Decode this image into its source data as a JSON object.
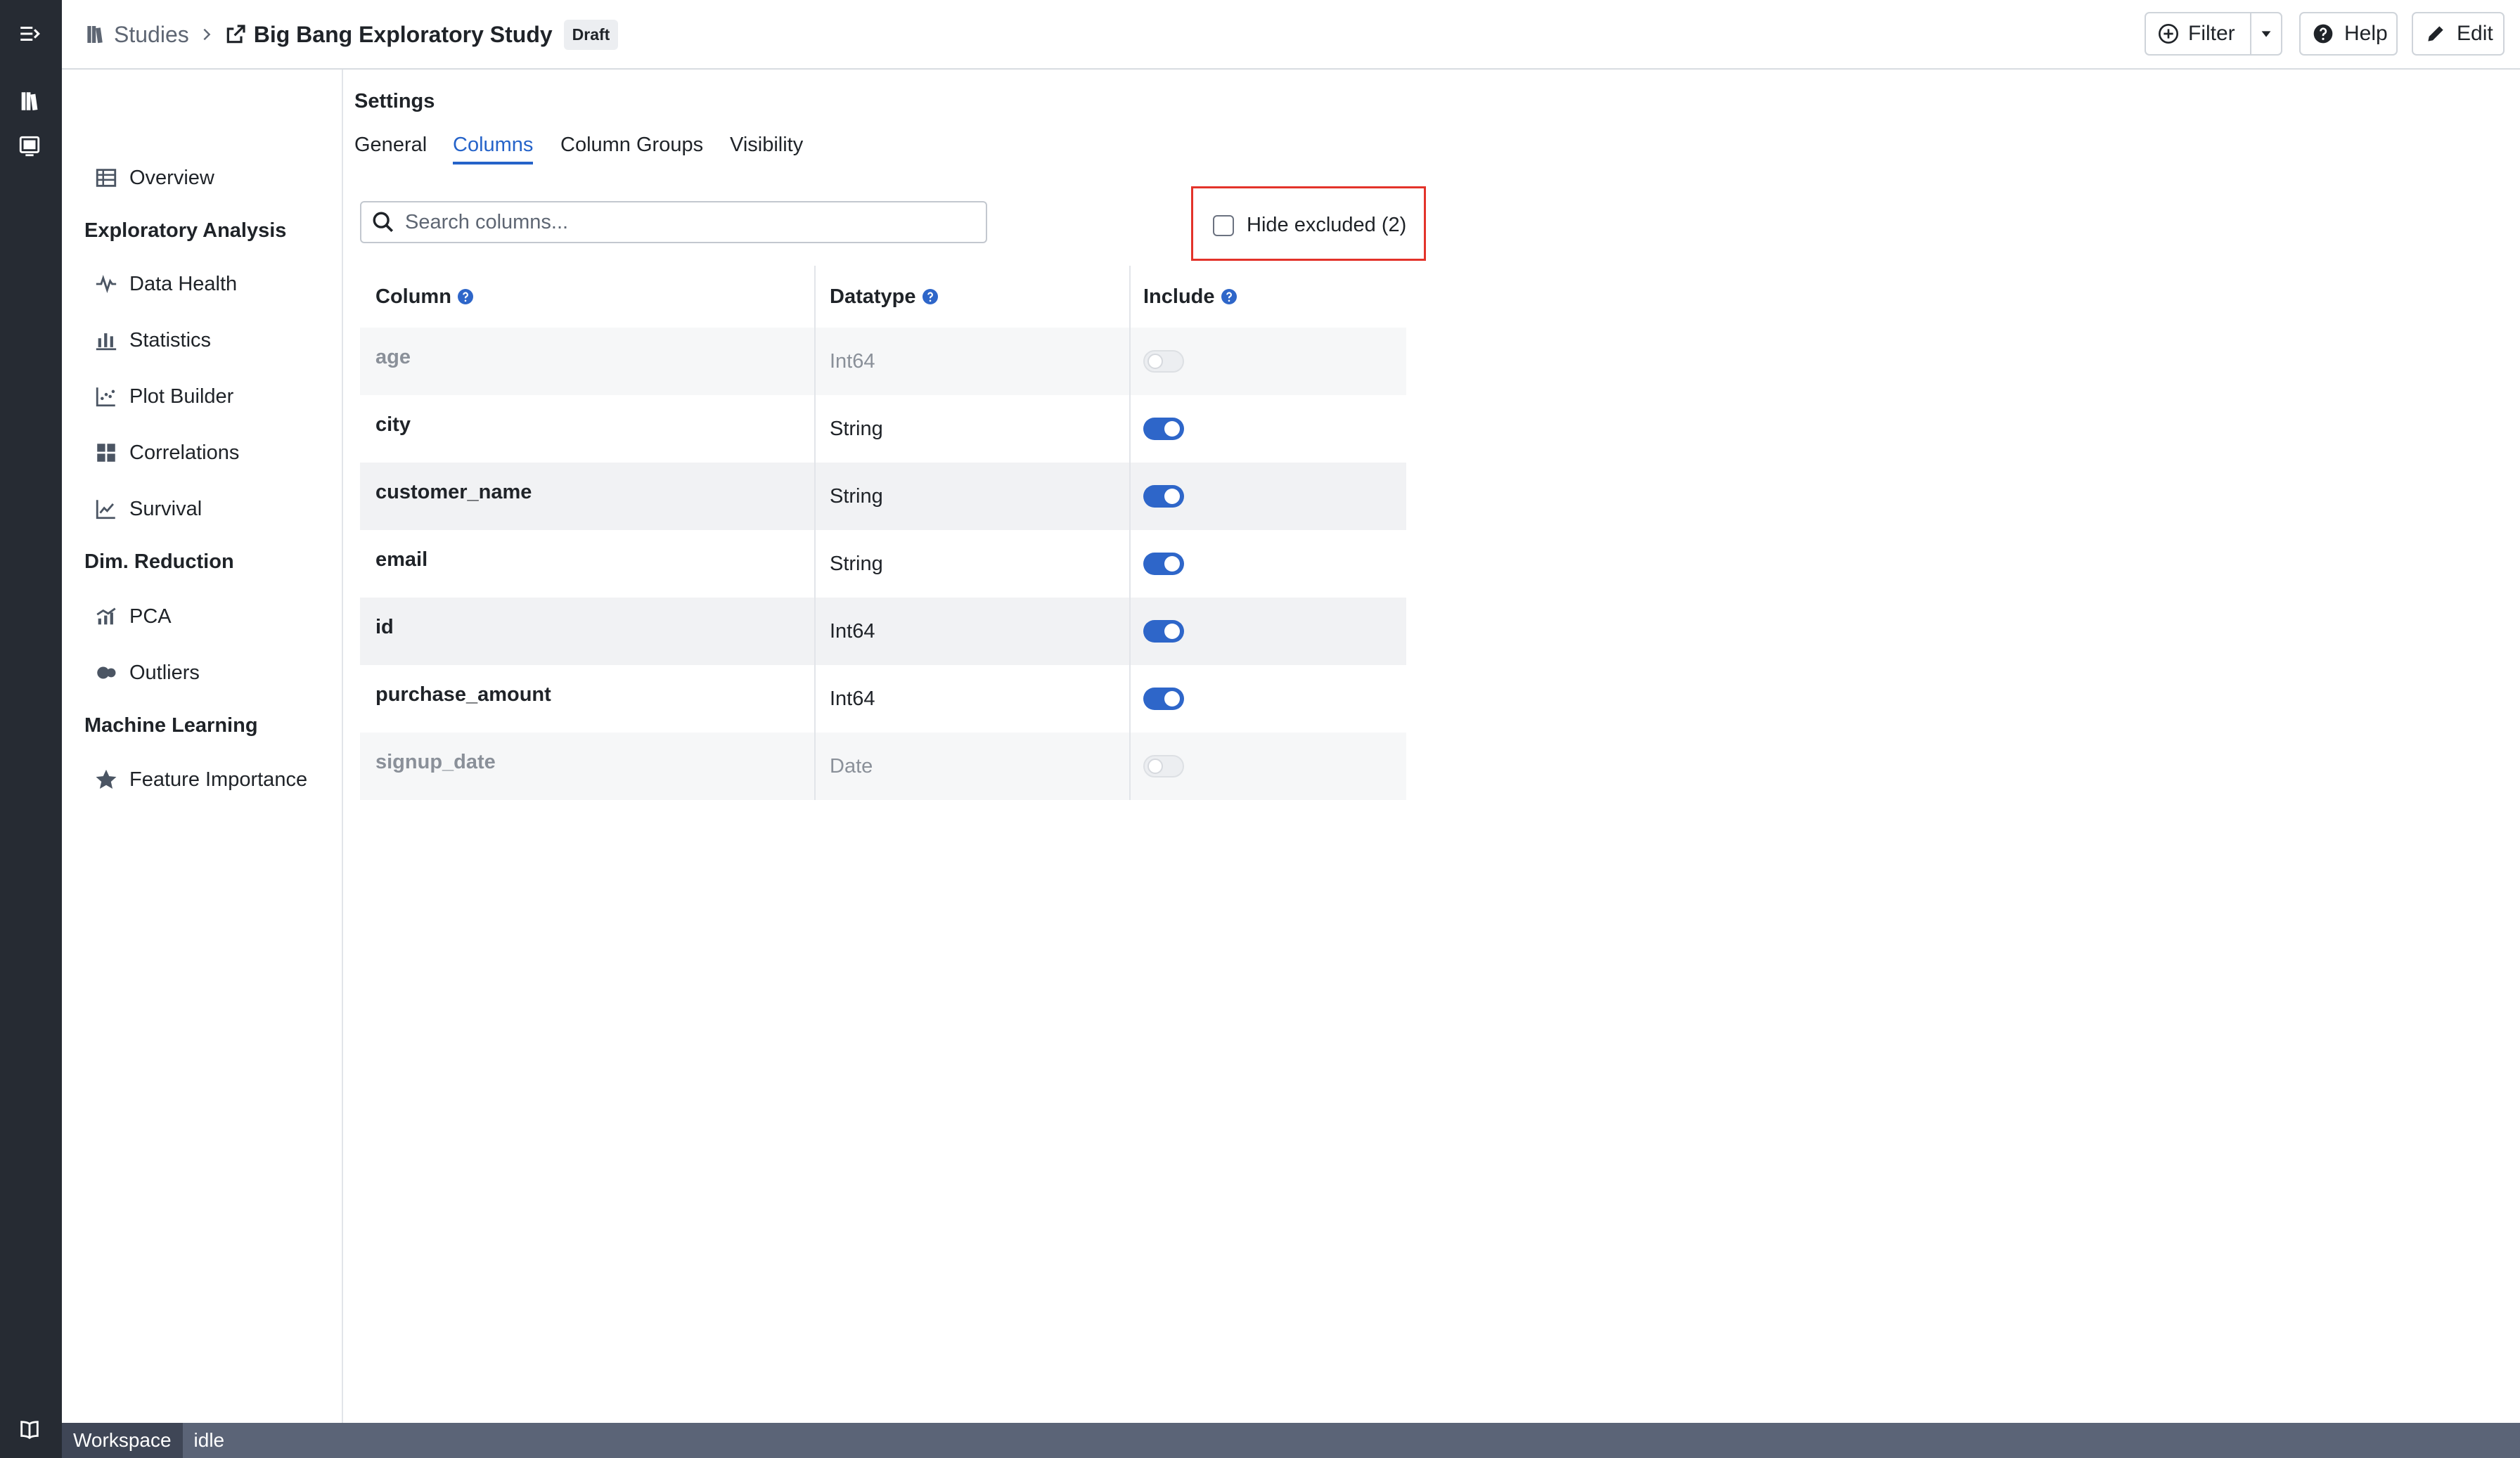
{
  "header": {
    "breadcrumb_root": "Studies",
    "study_title": "Big Bang Exploratory Study",
    "status_badge": "Draft",
    "filter_label": "Filter",
    "help_label": "Help",
    "edit_label": "Edit"
  },
  "sidebar": {
    "overview": "Overview",
    "sections": [
      {
        "title": "Exploratory Analysis",
        "items": [
          "Data Health",
          "Statistics",
          "Plot Builder",
          "Correlations",
          "Survival"
        ]
      },
      {
        "title": "Dim. Reduction",
        "items": [
          "PCA",
          "Outliers"
        ]
      },
      {
        "title": "Machine Learning",
        "items": [
          "Feature Importance"
        ]
      }
    ]
  },
  "main": {
    "title": "Settings",
    "tabs": [
      "General",
      "Columns",
      "Column Groups",
      "Visibility"
    ],
    "active_tab": "Columns",
    "search": {
      "placeholder": "Search columns...",
      "value": ""
    },
    "hide_excluded": {
      "label": "Hide excluded (2)",
      "checked": false
    },
    "table": {
      "headers": [
        "Column",
        "Datatype",
        "Include"
      ],
      "rows": [
        {
          "name": "age",
          "datatype": "Int64",
          "include": false
        },
        {
          "name": "city",
          "datatype": "String",
          "include": true
        },
        {
          "name": "customer_name",
          "datatype": "String",
          "include": true
        },
        {
          "name": "email",
          "datatype": "String",
          "include": true
        },
        {
          "name": "id",
          "datatype": "Int64",
          "include": true
        },
        {
          "name": "purchase_amount",
          "datatype": "Int64",
          "include": true
        },
        {
          "name": "signup_date",
          "datatype": "Date",
          "include": false
        }
      ]
    }
  },
  "statusbar": {
    "workspace_label": "Workspace",
    "status": "idle"
  },
  "colors": {
    "accent": "#2563c9",
    "toggle_on": "#2e66c9",
    "highlight_border": "#e3332a",
    "rail": "#262b33",
    "statusbar": "#5b6477"
  }
}
